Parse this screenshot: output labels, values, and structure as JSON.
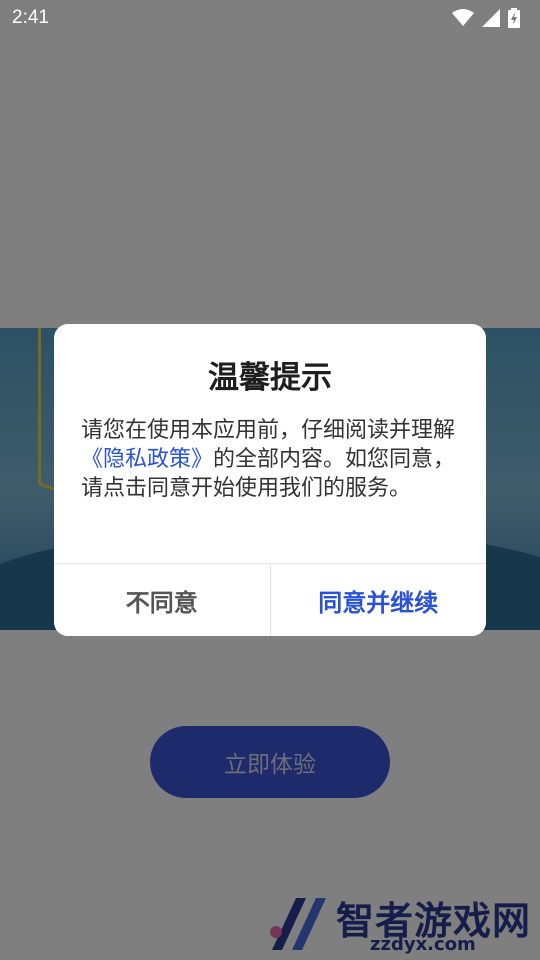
{
  "status_bar": {
    "time": "2:41",
    "icons": [
      "wifi-icon",
      "signal-icon",
      "battery-charging-icon"
    ]
  },
  "app": {
    "start_button_label": "立即体验"
  },
  "watermark": {
    "title": "智者游戏网",
    "domain": "zzdyx.com"
  },
  "dialog": {
    "title": "温馨提示",
    "body_before": "请您在使用本应用前，仔细阅读并理解",
    "privacy_link": "《隐私政策》",
    "body_after": "的全部内容。如您同意，请点击同意开始使用我们的服务。",
    "disagree_label": "不同意",
    "agree_label": "同意并继续"
  },
  "colors": {
    "accent": "#2a52d8",
    "overlay": "rgba(0,0,0,0.5)",
    "start_button": "#3a55d6"
  }
}
